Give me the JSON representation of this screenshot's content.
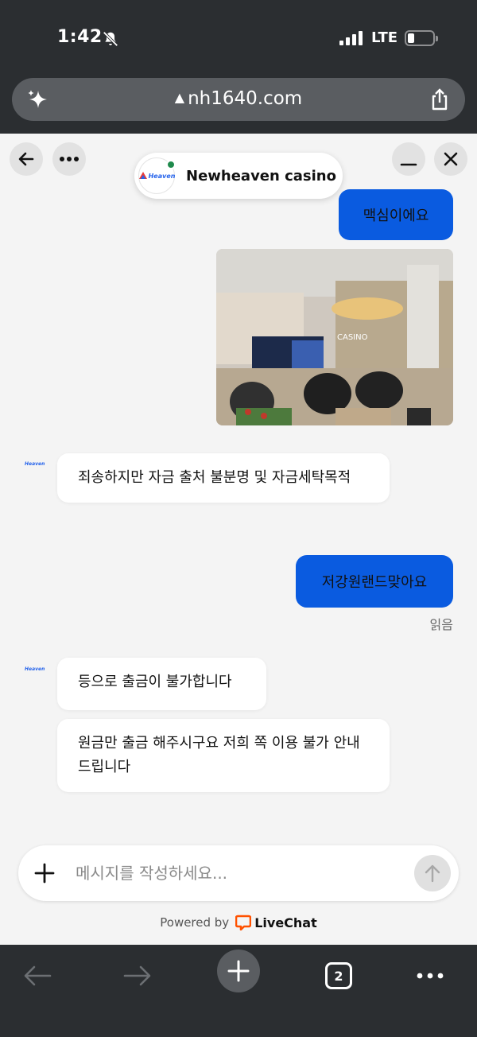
{
  "status_bar": {
    "time": "1:42",
    "network": "LTE"
  },
  "browser": {
    "url": "nh1640.com",
    "tab_count": "2"
  },
  "chat": {
    "agent_name": "Newheaven casino",
    "logo_text": "Heaven",
    "messages": {
      "out_1": "맥심이에요",
      "in_1": "죄송하지만 자금 출처 불분명 및 자금세탁목적",
      "out_2": "저강원랜드맞아요",
      "read_status": "읽음",
      "in_2": "등으로 출금이 불가합니다",
      "in_3": "원금만 출금 해주시구요 저희 쪽 이용 불가 안내 드립니다"
    },
    "photo_sign": "CASINO"
  },
  "composer": {
    "placeholder": "메시지를 작성하세요..."
  },
  "footer": {
    "powered_by": "Powered by",
    "brand": "LiveChat"
  },
  "colors": {
    "accent_blue": "#0a5be0",
    "chrome_dark": "#2b2e31",
    "online_green": "#1f8a4c",
    "livechat_orange": "#ff5100"
  }
}
